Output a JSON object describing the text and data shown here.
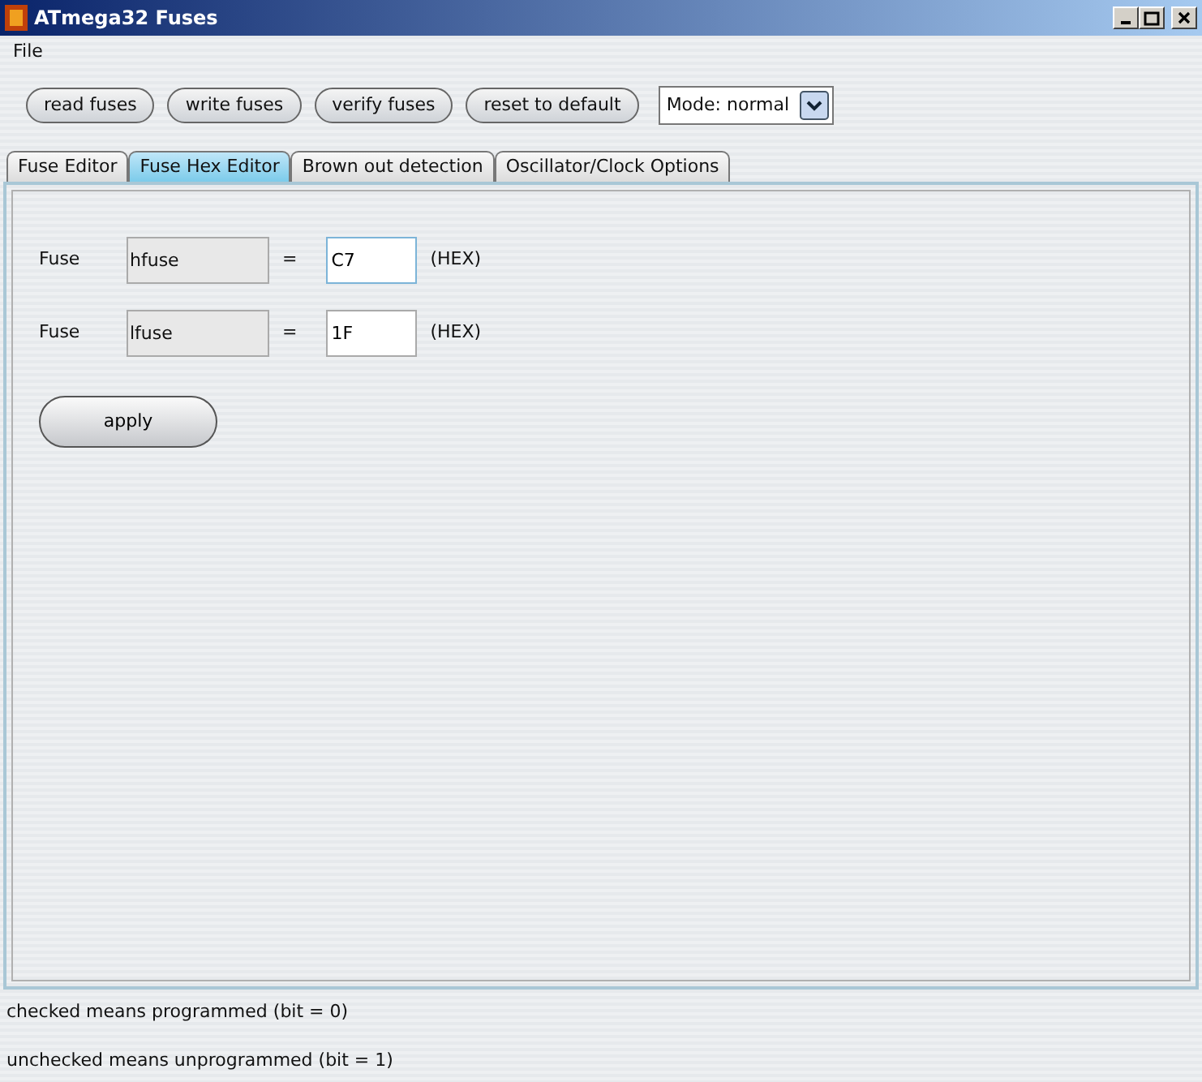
{
  "window": {
    "title": "ATmega32 Fuses"
  },
  "menu": [
    "File"
  ],
  "toolbar": {
    "buttons": [
      "read fuses",
      "write fuses",
      "verify fuses",
      "reset to default"
    ],
    "mode": {
      "value": "Mode: normal"
    }
  },
  "tabs": [
    {
      "label": "Fuse Editor",
      "selected": false
    },
    {
      "label": "Fuse Hex Editor",
      "selected": true
    },
    {
      "label": "Brown out detection",
      "selected": false
    },
    {
      "label": "Oscillator/Clock Options",
      "selected": false
    }
  ],
  "fuses": [
    {
      "label": "Fuse",
      "name": "hfuse",
      "equals": "=",
      "value": "C7",
      "unit": "(HEX)",
      "focused": true
    },
    {
      "label": "Fuse",
      "name": "lfuse",
      "equals": "=",
      "value": "1F",
      "unit": "(HEX)",
      "focused": false
    }
  ],
  "apply_button": "apply",
  "status": [
    "checked means programmed (bit = 0)",
    "unchecked means unprogrammed (bit = 1)"
  ]
}
